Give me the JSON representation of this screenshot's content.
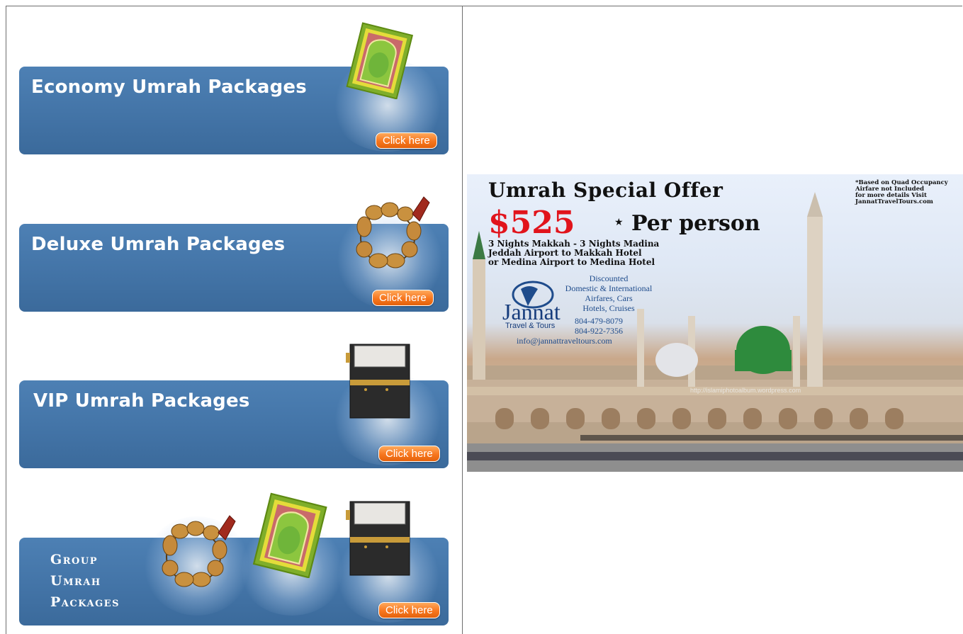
{
  "packages": [
    {
      "title": "Economy Umrah Packages",
      "button": "Click here",
      "icon": "prayer-rug-icon"
    },
    {
      "title": "Deluxe Umrah Packages",
      "button": "Click here",
      "icon": "prayer-beads-icon"
    },
    {
      "title": "VIP Umrah Packages",
      "button": "Click here",
      "icon": "kaaba-icon"
    },
    {
      "title_lines": [
        "Group",
        "Umrah",
        "Packages"
      ],
      "button": "Click here",
      "icons": [
        "prayer-beads-icon",
        "prayer-rug-icon",
        "kaaba-icon"
      ]
    }
  ],
  "offer": {
    "title": "Umrah Special Offer",
    "price": "$525",
    "per": "Per person",
    "note_lines": [
      "*Based on Quad Occupancy",
      "Airfare not Included",
      "for more details Visit",
      "JannatTravelTours.com"
    ],
    "details": [
      "3 Nights Makkah - 3 Nights Madina",
      "Jeddah Airport to Makkah Hotel",
      "or Medina Airport to Medina Hotel"
    ],
    "services": [
      "Discounted",
      "Domestic & International",
      "Airfares, Cars",
      "Hotels, Cruises"
    ],
    "brand": "Jannat",
    "brand_sub": "Travel & Tours",
    "phones": [
      "804-479-8079",
      "804-922-7356"
    ],
    "email": "info@jannattraveltours.com",
    "watermark": "http://islamiphotoalbum.wordpress.com"
  },
  "colors": {
    "banner": "#4374a7",
    "button": "#f7761e",
    "price": "#e1141c",
    "dome": "#2e8b3d"
  }
}
